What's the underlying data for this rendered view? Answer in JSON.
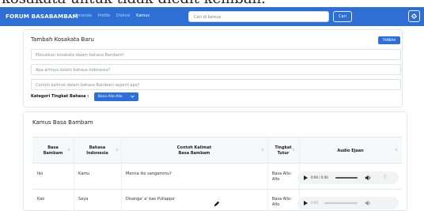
{
  "top_strip_text": "kosakata untuk tidak diedit kembali.",
  "navbar": {
    "brand": "FORUM BASABAMBAM",
    "links": [
      {
        "label": "Beranda",
        "active": false
      },
      {
        "label": "Profile",
        "active": false
      },
      {
        "label": "Diskusi",
        "active": false
      },
      {
        "label": "Kamus",
        "active": true
      }
    ],
    "search_placeholder": "Cari di kamus",
    "search_button": "Cari",
    "settings_icon": "gear-icon"
  },
  "add_form": {
    "title": "Tambah Kosakata Baru",
    "add_button": "TAMBAH",
    "field_word_placeholder": "Masukkan kosakata dalam bahasa Bambam!",
    "field_meaning_placeholder": "Apa artinya dalam bahasa Indonesia?",
    "field_example_placeholder": "Contoh kalimat dalam bahasa Bambam seperti apa?",
    "category_label": "Kategori Tingkat Bahasa :",
    "category_selected": "Basa Allo-Allo"
  },
  "dictionary": {
    "title": "Kamus Basa Bambam",
    "columns": [
      "Basa\nBambam",
      "Bahasa\nIndonesia",
      "Contoh Kalimat\nBasa Bambam",
      "Tingkat\nTutur",
      "Audio Ejaan"
    ],
    "rows": [
      {
        "bambam": "Iko",
        "indonesia": "Kamu",
        "contoh": "Menna iko sangammu?",
        "tingkat": "Basa Allo-\nAllo",
        "audio_time": "0:00 / 0:40"
      },
      {
        "bambam": "Kao",
        "indonesia": "Saya",
        "contoh": "Disanga' a' kao Pullappa'",
        "tingkat": "Basa Allo-\nAllo",
        "audio_time": "0:00"
      }
    ]
  },
  "colors": {
    "primary": "#2e6fd6",
    "header_bg": "#f7f8fa",
    "border": "#e3e6ea"
  }
}
